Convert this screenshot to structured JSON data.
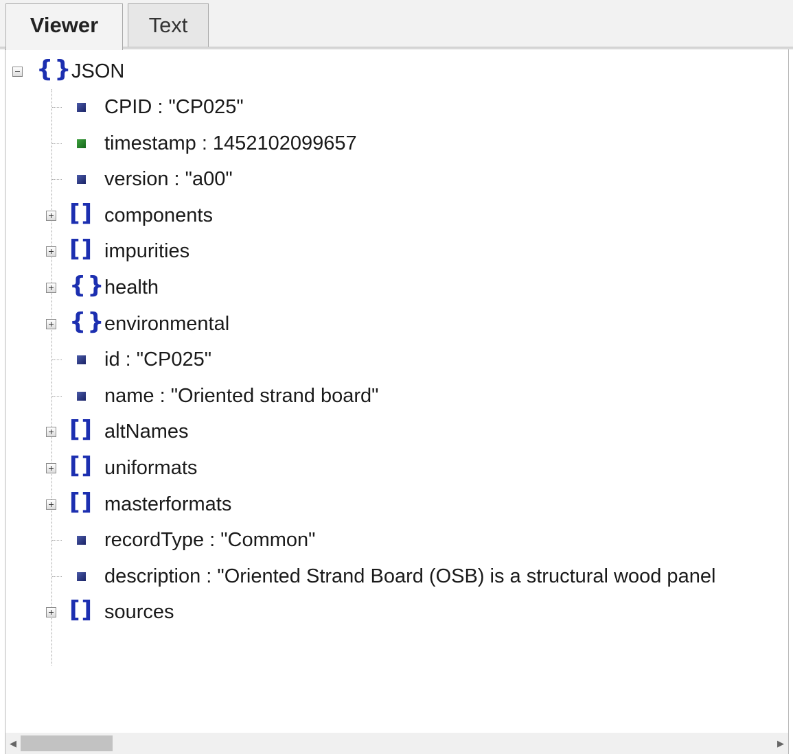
{
  "tabs": [
    {
      "label": "Viewer",
      "active": true
    },
    {
      "label": "Text",
      "active": false
    }
  ],
  "tree": {
    "root": {
      "label": "JSON",
      "type": "object",
      "expanded": true
    },
    "children": [
      {
        "kind": "leaf",
        "value_type": "string",
        "label": "CPID : \"CP025\""
      },
      {
        "kind": "leaf",
        "value_type": "number",
        "label": "timestamp : 1452102099657"
      },
      {
        "kind": "leaf",
        "value_type": "string",
        "label": "version : \"a00\""
      },
      {
        "kind": "node",
        "type": "array",
        "label": "components"
      },
      {
        "kind": "node",
        "type": "array",
        "label": "impurities"
      },
      {
        "kind": "node",
        "type": "object",
        "label": "health"
      },
      {
        "kind": "node",
        "type": "object",
        "label": "environmental"
      },
      {
        "kind": "leaf",
        "value_type": "string",
        "label": "id : \"CP025\""
      },
      {
        "kind": "leaf",
        "value_type": "string",
        "label": "name : \"Oriented strand board\""
      },
      {
        "kind": "node",
        "type": "array",
        "label": "altNames"
      },
      {
        "kind": "node",
        "type": "array",
        "label": "uniformats"
      },
      {
        "kind": "node",
        "type": "array",
        "label": "masterformats"
      },
      {
        "kind": "leaf",
        "value_type": "string",
        "label": "recordType : \"Common\""
      },
      {
        "kind": "leaf",
        "value_type": "string",
        "label": "description : \"Oriented Strand Board (OSB) is a structural wood panel"
      },
      {
        "kind": "node",
        "type": "array",
        "label": "sources"
      }
    ]
  },
  "icons": {
    "object": "curly-braces-icon",
    "array": "square-brackets-icon",
    "string_leaf": "blue-square-icon",
    "number_leaf": "green-square-icon",
    "expand": "plus-box-icon",
    "collapse": "minus-box-icon"
  },
  "colors": {
    "bracket": "#1c2fb0",
    "string_leaf": "#2b3a8a",
    "number_leaf": "#2a8a2a"
  },
  "scrollbar": {
    "left_arrow": "◀",
    "right_arrow": "▶"
  }
}
